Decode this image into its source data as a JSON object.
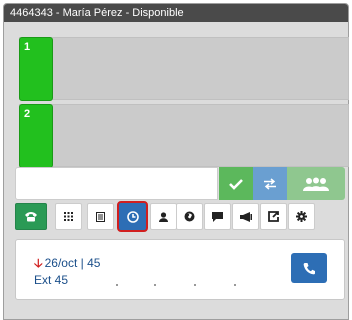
{
  "header": {
    "title": "4464343 - María Pérez - Disponible"
  },
  "lines": [
    {
      "number": "1",
      "status": "available",
      "status_color": "#22c01e"
    },
    {
      "number": "2",
      "status": "available",
      "status_color": "#22c01e"
    }
  ],
  "dialer": {
    "input_value": "",
    "accept_icon": "check-icon",
    "transfer_icon": "transfer-icon",
    "conference_icon": "users-icon"
  },
  "toolbar": {
    "icons": [
      "phone-icon",
      "keypad-icon",
      "list-icon",
      "clock-icon",
      "user-icon",
      "globe-icon",
      "chat-icon",
      "megaphone-icon",
      "share-icon",
      "gear-icon"
    ],
    "active": "clock-icon",
    "active_color": "#2d6eb5",
    "highlight_color": "#d11f1f"
  },
  "recent_call": {
    "direction_icon": "arrow-down-icon",
    "date_label": "26/oct | 45",
    "ext_label": "Ext 45"
  }
}
